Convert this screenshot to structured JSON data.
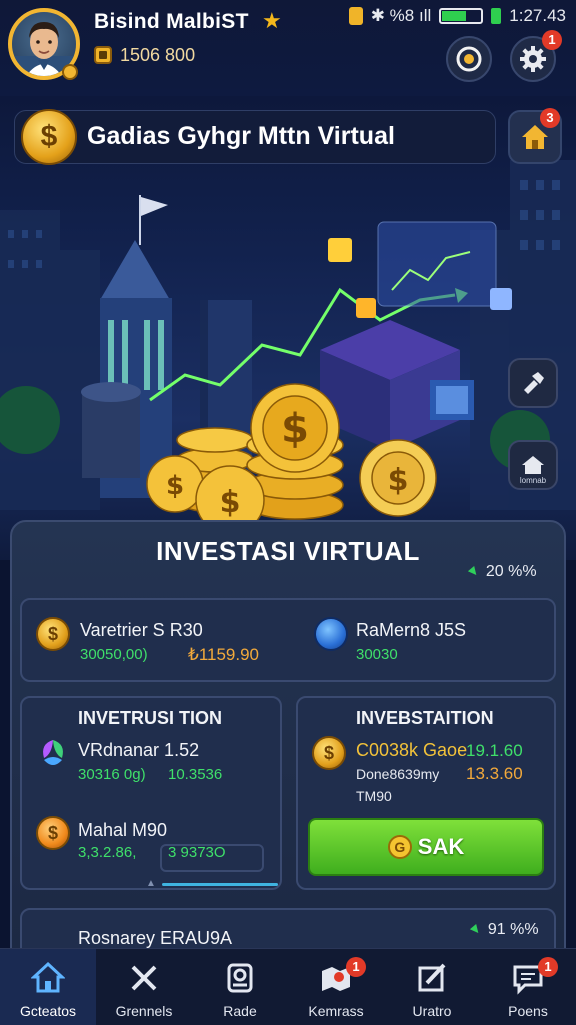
{
  "player": {
    "name": "Bisind MalbiST",
    "coins": "1506 800"
  },
  "status_bar": {
    "indicators": "✱ %8 ıll",
    "battery": "78",
    "time": "1:27.43"
  },
  "badges": {
    "settings": "1",
    "home": "3",
    "nav_kemrass": "1",
    "nav_poens": "1"
  },
  "banner": {
    "title": "Gadias Gyhgr Mttn Virtual"
  },
  "side_buttons": {
    "second_label": "lomnab"
  },
  "panel": {
    "title": "INVESTASI VIRTUAL",
    "change": "20 %%",
    "summary": {
      "left_name": "Varetrier S R30",
      "left_code": "30050,00)",
      "left_value": "₺1159.90",
      "right_name": "RaMern8 J5S",
      "right_value": "30030"
    },
    "left_card": {
      "heading": "INVETRUSI TION",
      "items": [
        {
          "name": "VRdnanar 1.52",
          "sub": "30316 0g)",
          "value": "10.3536"
        },
        {
          "name": "Mahal M90",
          "sub": "3,3.2.86,",
          "value": "3 9373O"
        }
      ]
    },
    "right_card": {
      "heading": "INVEBSTAITION",
      "name": "C0038k Gaoe",
      "name_value": "19.1.60",
      "sub": "Done8639my",
      "sub_value": "13.3.60",
      "extra": "TM90",
      "button": "SAK",
      "button_coin": "G"
    },
    "bottom_row": {
      "name": "Rosnarey ERAU9A",
      "change": "91 %%"
    }
  },
  "nav": [
    {
      "label": "Gcteatos",
      "icon": "home-icon",
      "active": true
    },
    {
      "label": "Grennels",
      "icon": "tools-icon",
      "active": false
    },
    {
      "label": "Rade",
      "icon": "bank-icon",
      "active": false
    },
    {
      "label": "Kemrass",
      "icon": "map-icon",
      "active": false
    },
    {
      "label": "Uratro",
      "icon": "edit-icon",
      "active": false
    },
    {
      "label": "Poens",
      "icon": "chat-icon",
      "active": false
    }
  ],
  "colors": {
    "accent_gold": "#f2b632",
    "positive_green": "#3fe06a",
    "value_orange": "#f2a93b",
    "button_green": "#4fc425",
    "notification_red": "#e23a28"
  }
}
